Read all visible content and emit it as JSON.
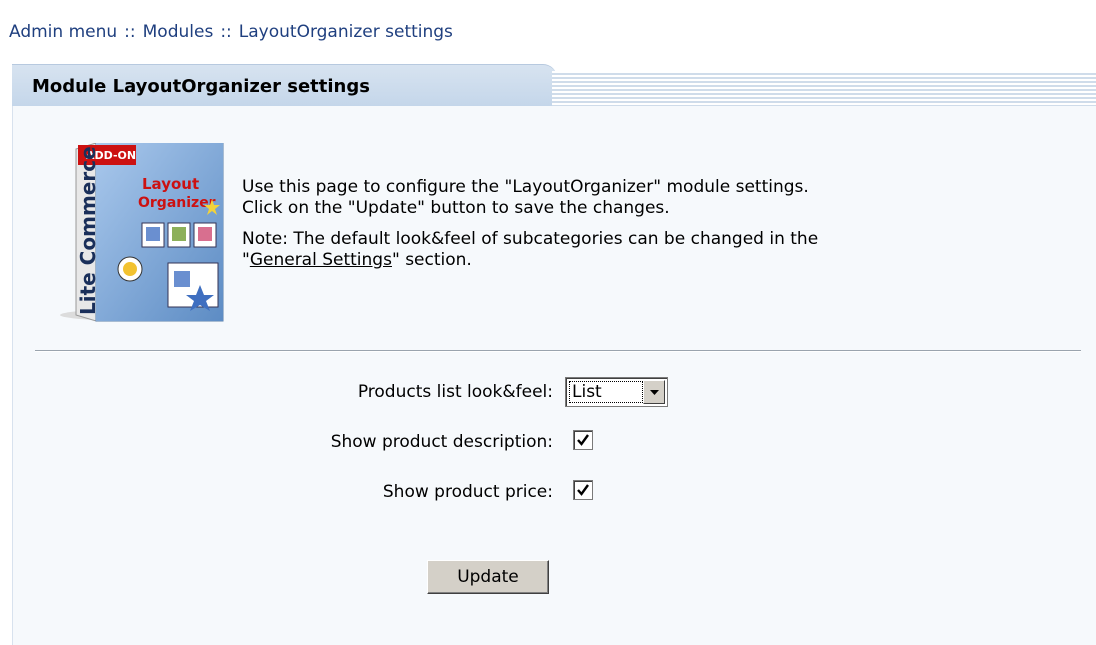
{
  "breadcrumb": {
    "items": [
      "Admin menu",
      "Modules",
      "LayoutOrganizer settings"
    ],
    "separator": "::"
  },
  "panel": {
    "title": "Module LayoutOrganizer settings"
  },
  "box_art": {
    "addon": "ADD-ON",
    "brand": "Lite Commerce",
    "product_line1": "Layout",
    "product_line2": "Organizer"
  },
  "description": {
    "line1": "Use this page to configure the \"LayoutOrganizer\" module settings.",
    "line2": "Click on the \"Update\" button to save the changes.",
    "note_prefix": "Note: The default look&feel of subcategories can be changed in the",
    "note_quote_open": "\"",
    "note_link": "General Settings",
    "note_suffix": "\" section."
  },
  "form": {
    "look_label": "Products list look&feel:",
    "look_value": "List",
    "show_description_label": "Show product description:",
    "show_description_checked": true,
    "show_price_label": "Show product price:",
    "show_price_checked": true,
    "update_label": "Update"
  },
  "colors": {
    "accent": "#c4d6ea",
    "link": "#1f3f7f"
  }
}
